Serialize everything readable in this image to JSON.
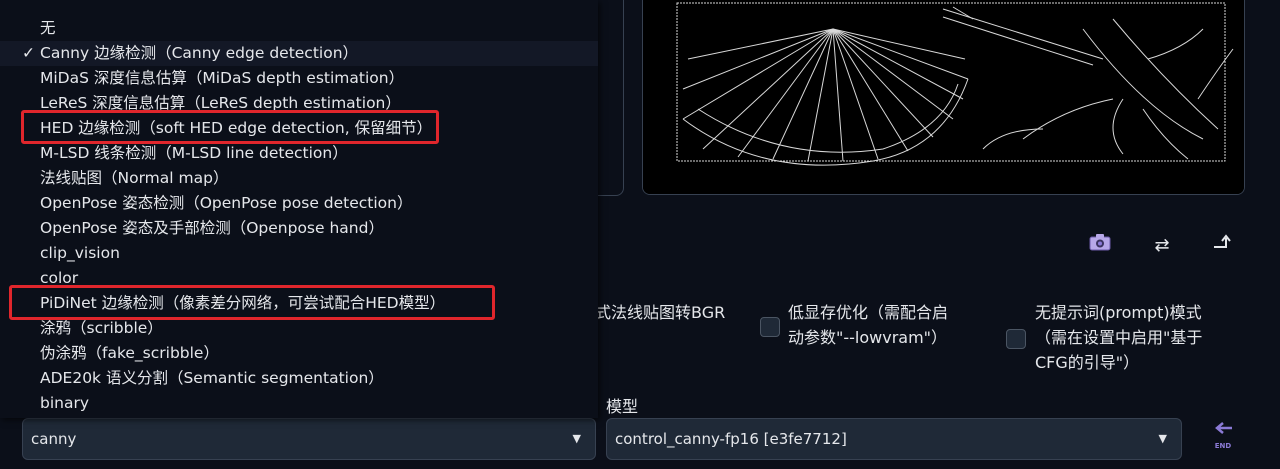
{
  "dropdown": {
    "items": [
      {
        "label": "无",
        "selected": false
      },
      {
        "label": "Canny 边缘检测（Canny edge detection）",
        "selected": true
      },
      {
        "label": "MiDaS 深度信息估算（MiDaS depth estimation）",
        "selected": false
      },
      {
        "label": "LeReS 深度信息估算（LeReS depth estimation）",
        "selected": false
      },
      {
        "label": "HED 边缘检测（soft HED edge detection, 保留细节）",
        "selected": false
      },
      {
        "label": "M-LSD 线条检测（M-LSD line detection）",
        "selected": false
      },
      {
        "label": "法线贴图（Normal map）",
        "selected": false
      },
      {
        "label": "OpenPose 姿态检测（OpenPose pose detection）",
        "selected": false
      },
      {
        "label": "OpenPose 姿态及手部检测（Openpose hand）",
        "selected": false
      },
      {
        "label": "clip_vision",
        "selected": false
      },
      {
        "label": "color",
        "selected": false
      },
      {
        "label": "PiDiNet 边缘检测（像素差分网络，可尝试配合HED模型）",
        "selected": false
      },
      {
        "label": "涂鸦（scribble）",
        "selected": false
      },
      {
        "label": "伪涂鸦（fake_scribble）",
        "selected": false
      },
      {
        "label": "ADE20k 语义分割（Semantic segmentation）",
        "selected": false
      },
      {
        "label": "binary",
        "selected": false
      }
    ],
    "check_mark": "✓"
  },
  "toolbar": {
    "camera_icon": "camera-icon",
    "swap_icon": "swap-icon",
    "send_icon": "send-up-icon"
  },
  "options": {
    "normal_bgr_partial": "式法线贴图转BGR",
    "low_vram_line1": "低显存优化（需配合启",
    "low_vram_line2": "动参数\"--lowvram\"）",
    "guess_mode_line1": "无提示词(prompt)模式",
    "guess_mode_line2": "（需在设置中启用\"基于",
    "guess_mode_line3": "CFG的引导\"）"
  },
  "preprocessor_select": {
    "value": "canny"
  },
  "model": {
    "label": "模型",
    "value": "control_canny-fp16 [e3fe7712]"
  },
  "end_button": {
    "label": "END"
  },
  "colors": {
    "background": "#0b0f19",
    "highlight": "#e0262c",
    "accent": "#8b7ad6"
  }
}
